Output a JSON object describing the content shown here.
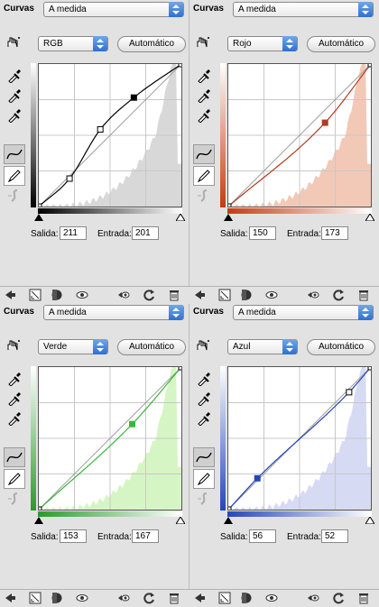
{
  "header_label": "Curvas",
  "preset_value": "A medida",
  "auto_button": "Automático",
  "salida_label": "Salida:",
  "entrada_label": "Entrada:",
  "panels": [
    {
      "channel": "RGB",
      "salida": "211",
      "entrada": "201",
      "color": "#000000",
      "hist_color": "#d8d8d8",
      "grad_color": "#000000",
      "points": [
        [
          0,
          0
        ],
        [
          55,
          50
        ],
        [
          110,
          138
        ],
        [
          170,
          195
        ],
        [
          255,
          255
        ]
      ],
      "hollow": [
        true,
        true,
        true,
        false,
        true
      ]
    },
    {
      "channel": "Rojo",
      "salida": "150",
      "entrada": "173",
      "color": "#b33a1e",
      "hist_color": "#f2c9b6",
      "grad_color": "#c43b12",
      "points": [
        [
          0,
          0
        ],
        [
          173,
          150
        ],
        [
          255,
          255
        ]
      ],
      "hollow": [
        true,
        false,
        true
      ]
    },
    {
      "channel": "Verde",
      "salida": "153",
      "entrada": "167",
      "color": "#3cb43c",
      "hist_color": "#d6f5c4",
      "grad_color": "#2b9a2b",
      "points": [
        [
          0,
          0
        ],
        [
          167,
          153
        ],
        [
          255,
          255
        ]
      ],
      "hollow": [
        true,
        false,
        true
      ]
    },
    {
      "channel": "Azul",
      "salida": "56",
      "entrada": "52",
      "color": "#2446b8",
      "hist_color": "#d6daf3",
      "grad_color": "#2446b8",
      "points": [
        [
          0,
          0
        ],
        [
          52,
          56
        ],
        [
          216,
          210
        ],
        [
          255,
          255
        ]
      ],
      "hollow": [
        true,
        false,
        true,
        true
      ]
    }
  ],
  "icons": {
    "hand": "target-adjust-hand-icon",
    "eyedropper_black": "black-point-eyedropper-icon",
    "eyedropper_gray": "gray-point-eyedropper-icon",
    "eyedropper_white": "white-point-eyedropper-icon",
    "curve_tool": "curve-point-tool-icon",
    "pencil_tool": "pencil-draw-tool-icon",
    "smooth_tool": "smooth-curve-icon",
    "footer": [
      "back-arrow-icon",
      "clip-layer-icon",
      "layer-mask-icon",
      "visibility-eye-icon",
      "view-previous-icon",
      "reset-icon",
      "trash-icon"
    ]
  }
}
